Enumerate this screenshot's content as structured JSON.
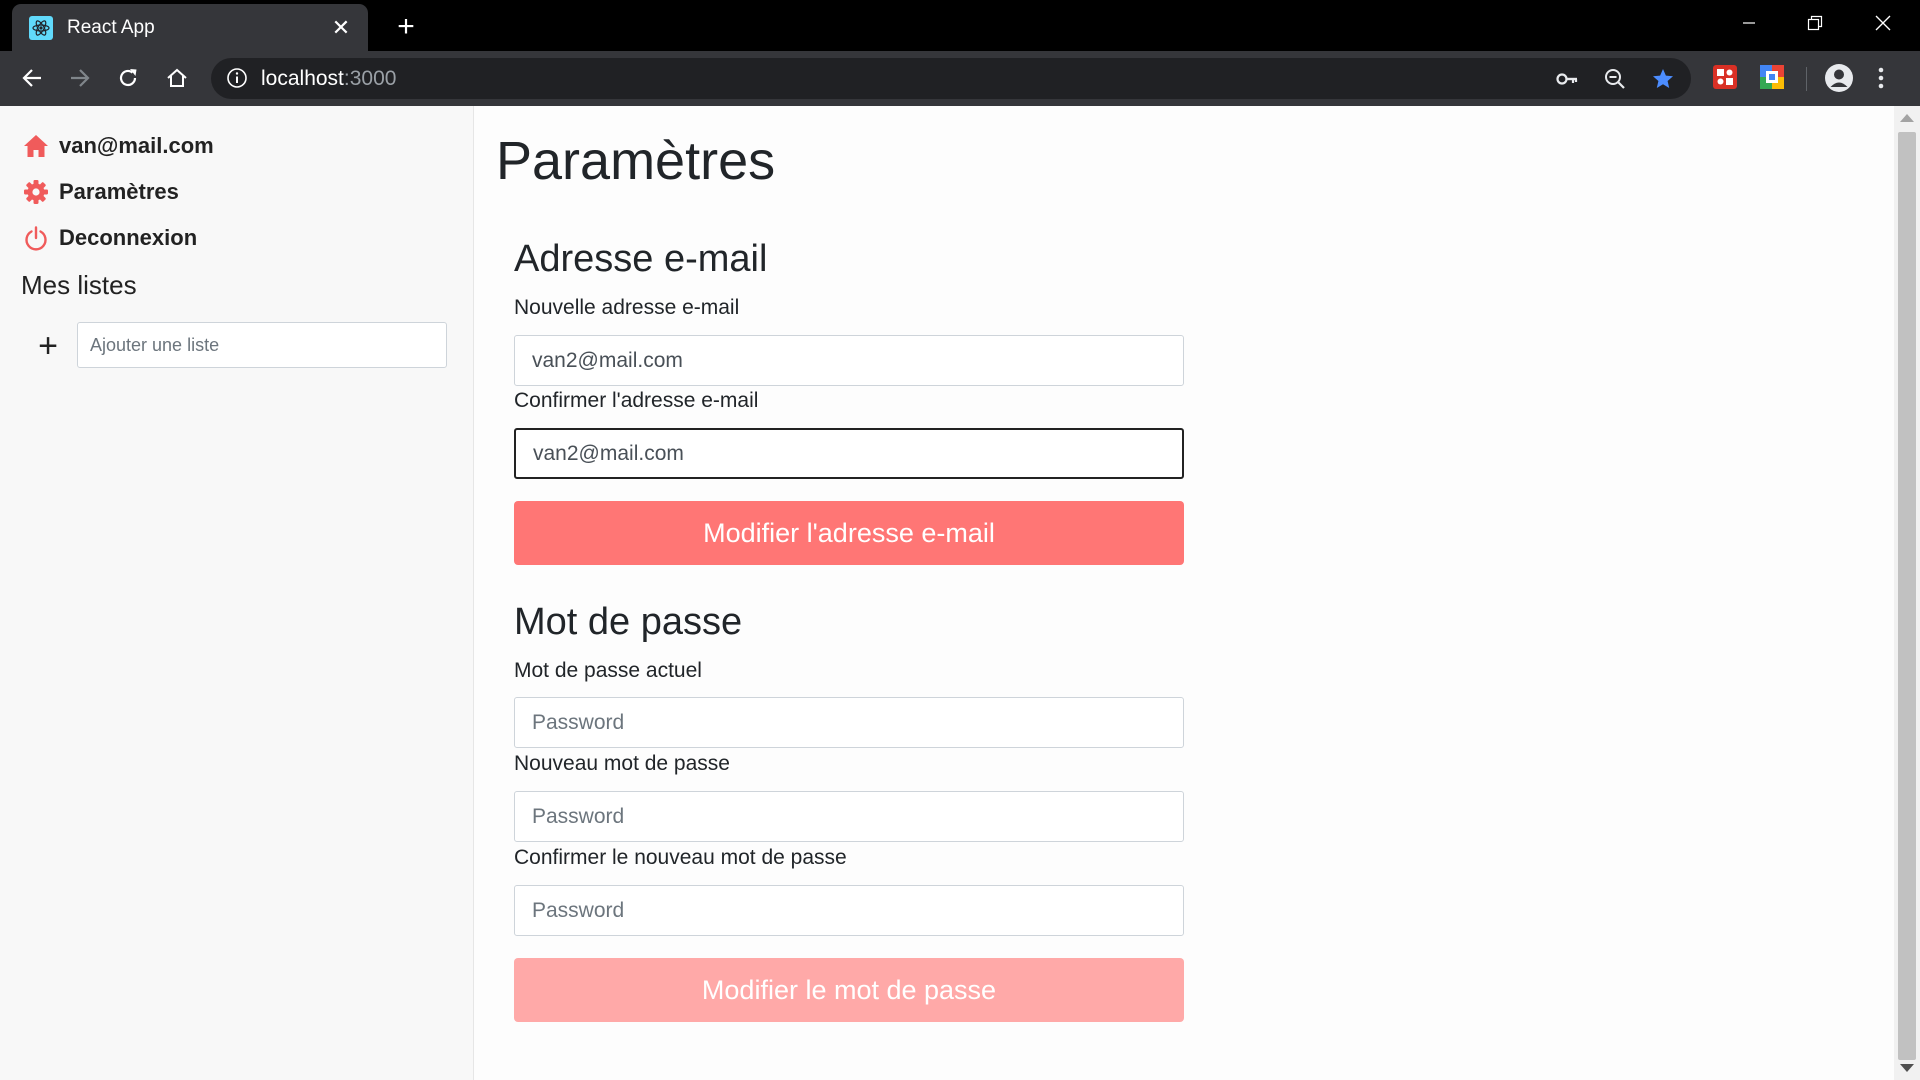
{
  "browser": {
    "tab_title": "React App",
    "tab_close": "✕",
    "new_tab": "+",
    "url_host": "localhost",
    "url_port": ":3000"
  },
  "sidebar": {
    "user_email": "van@mail.com",
    "settings_label": "Paramètres",
    "logout_label": "Deconnexion",
    "lists_heading": "Mes listes",
    "add_list_button": "+",
    "add_list_placeholder": "Ajouter une liste"
  },
  "main": {
    "title": "Paramètres",
    "email_section": {
      "title": "Adresse e-mail",
      "new_label": "Nouvelle adresse e-mail",
      "new_value": "van2@mail.com",
      "confirm_label": "Confirmer l'adresse e-mail",
      "confirm_value": "van2@mail.com",
      "submit_label": "Modifier l'adresse e-mail"
    },
    "password_section": {
      "title": "Mot de passe",
      "current_label": "Mot de passe actuel",
      "current_placeholder": "Password",
      "new_label": "Nouveau mot de passe",
      "new_placeholder": "Password",
      "confirm_label": "Confirmer le nouveau mot de passe",
      "confirm_placeholder": "Password",
      "submit_label": "Modifier le mot de passe"
    }
  },
  "colors": {
    "accent": "#ff7675",
    "accent_disabled": "#ffa9a8",
    "icon_red": "#f05b5b"
  }
}
